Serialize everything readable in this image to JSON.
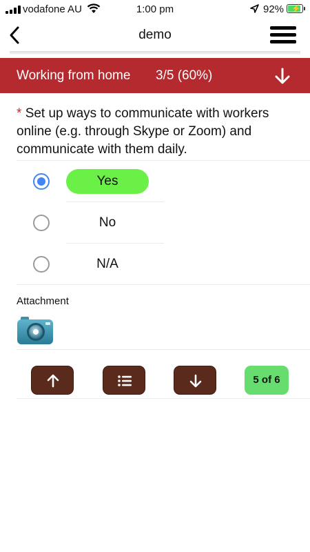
{
  "status_bar": {
    "carrier": "vodafone AU",
    "time": "1:00 pm",
    "battery_percent": "92%",
    "battery_level": 0.92,
    "icons": [
      "signal-icon",
      "wifi-icon",
      "location-icon",
      "battery-charging-icon"
    ]
  },
  "nav": {
    "title": "demo",
    "back_icon": "chevron-left-icon",
    "menu_icon": "hamburger-menu-icon"
  },
  "section": {
    "title": "Working from home",
    "progress": "3/5 (60%)",
    "toggle_icon": "arrow-down-icon",
    "color": "#b52a2e"
  },
  "question": {
    "required_marker": "*",
    "text": "Set up ways to communicate with workers online (e.g. through Skype or Zoom) and communicate with them daily.",
    "options": [
      {
        "label": "Yes",
        "selected": true
      },
      {
        "label": "No",
        "selected": false
      },
      {
        "label": "N/A",
        "selected": false
      }
    ],
    "selected_color": "#6af046"
  },
  "attachment": {
    "label": "Attachment",
    "icon": "camera-icon"
  },
  "bottom_nav": {
    "prev_icon": "arrow-up-icon",
    "list_icon": "list-icon",
    "next_icon": "arrow-down-icon",
    "counter": "5 of 6",
    "button_color": "#5a2a1c",
    "counter_color": "#66dd6e"
  }
}
